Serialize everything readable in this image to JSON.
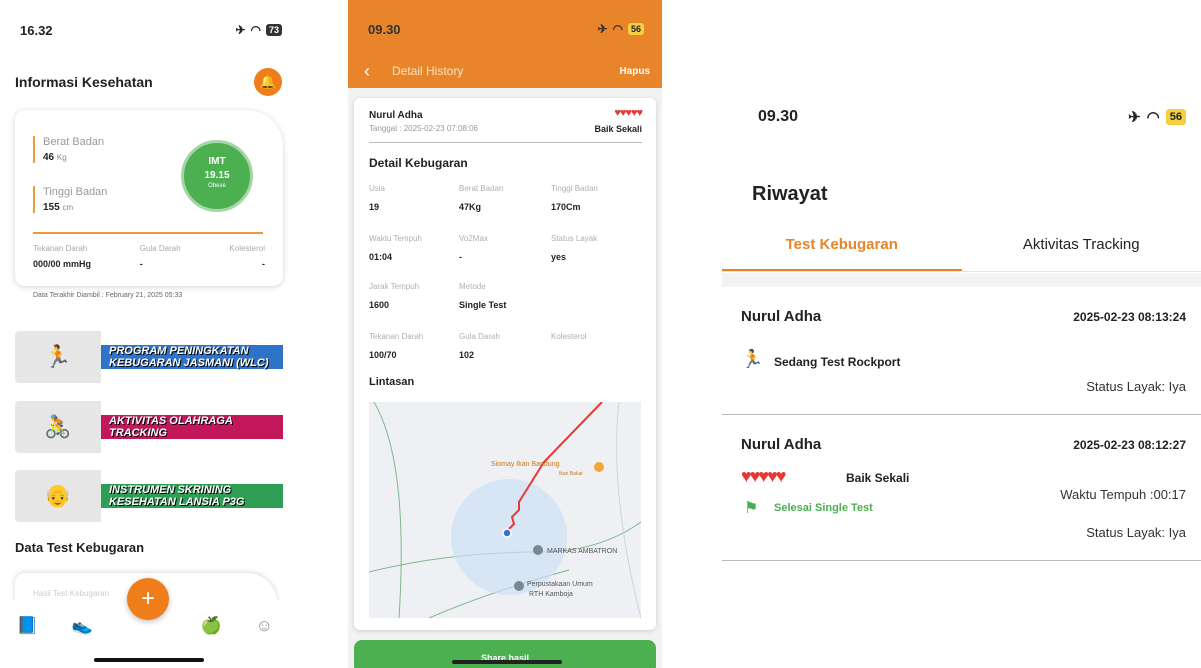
{
  "screen1": {
    "time": "16.32",
    "battery": "73",
    "title": "Informasi Kesehatan",
    "berat_label": "Berat Badan",
    "berat_value": "46",
    "berat_unit": "Kg",
    "tinggi_label": "Tinggi Badan",
    "tinggi_value": "155",
    "tinggi_unit": "cm",
    "imt_label": "IMT",
    "imt_value": "19.15",
    "imt_status": "Obese",
    "tekanan_label": "Tekanan Darah",
    "tekanan_value": "000/00 mmHg",
    "gula_label": "Gula Darah",
    "gula_value": "-",
    "kolesterol_label": "Kolesterol",
    "kolesterol_value": "-",
    "last_data": "Data Terakhir Diambil : February 21, 2025 05:33",
    "banners": [
      {
        "text": "PROGRAM PENINGKATAN KEBUGARAN JASMANI (WLC)",
        "color": "#2f73c9"
      },
      {
        "text": "AKTIVITAS OLAHRAGA TRACKING",
        "color": "#c2185b"
      },
      {
        "text": "INSTRUMEN SKRINING KESEHATAN LANSIA P3G",
        "color": "#2e9e55"
      }
    ],
    "section_title": "Data Test Kebugaran",
    "card_label": "Hasil Test Kebugaran",
    "fab_label": "+",
    "accent": "#ef7d1a"
  },
  "screen2": {
    "time": "09.30",
    "battery": "56",
    "nav_title": "Detail History",
    "hapus": "Hapus",
    "name": "Nurul Adha",
    "tanggal": "Tanggal : 2025-02-23 07:08:06",
    "hearts": "♥♥♥♥♥",
    "rating": "Baik Sekali",
    "detail_title": "Detail Kebugaran",
    "fields": [
      {
        "label": "Usia",
        "value": "19"
      },
      {
        "label": "Berat Badan",
        "value": "47Kg"
      },
      {
        "label": "Tinggi Badan",
        "value": "170Cm"
      },
      {
        "label": "Waktu Tempuh",
        "value": "01:04"
      },
      {
        "label": "Vo2Max",
        "value": "-"
      },
      {
        "label": "Status Layak",
        "value": "yes"
      },
      {
        "label": "Jarak Tempuh",
        "value": "1600"
      },
      {
        "label": "Metode",
        "value": "Single Test"
      },
      {
        "label": "Tekanan Darah",
        "value": "100/70"
      },
      {
        "label": "Gula Darah",
        "value": "102"
      },
      {
        "label": "Kolesterol",
        "value": ""
      }
    ],
    "lintasan_title": "Lintasan",
    "map_labels": {
      "siomay": "Siomay Ikan Bandung",
      "siomay_sub": "Ikan Bakar",
      "markas": "MARKAS AMBATRON",
      "perpus": "Perpustakaan Umum",
      "perpus_sub": "RTH Kamboja"
    },
    "share": "Share hasil",
    "accent": "#e8852a"
  },
  "screen3": {
    "time": "09.30",
    "battery": "56",
    "title": "Riwayat",
    "tabs": [
      "Test Kebugaran",
      "Aktivitas Tracking"
    ],
    "records": [
      {
        "name": "Nurul Adha",
        "date": "2025-02-23 08:13:24",
        "status": "Sedang Test Rockport",
        "layak": "Status Layak: Iya"
      },
      {
        "name": "Nurul Adha",
        "date": "2025-02-23 08:12:27",
        "hearts": "♥♥♥♥♥",
        "rating": "Baik Sekali",
        "status": "Selesai Single Test",
        "waktu": "Waktu Tempuh :00:17",
        "layak": "Status Layak: Iya"
      }
    ]
  }
}
